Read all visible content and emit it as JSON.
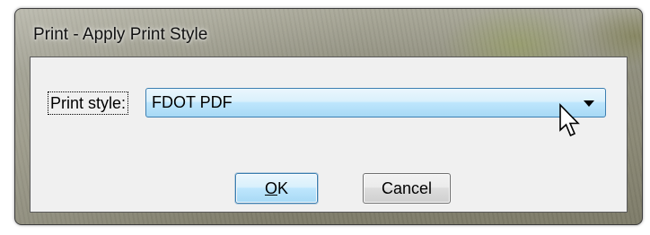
{
  "window": {
    "title": "Print - Apply Print Style"
  },
  "form": {
    "print_style_label": "Print style:",
    "print_style_value": "FDOT PDF"
  },
  "buttons": {
    "ok_label": "OK",
    "ok_mnemonic": "O",
    "ok_rest": "K",
    "cancel_label": "Cancel"
  },
  "icons": {
    "dropdown": "chevron-down-icon",
    "cursor": "mouse-pointer-icon"
  },
  "colors": {
    "accent_border": "#3c7fb1",
    "client_bg": "#f0f0f0"
  }
}
